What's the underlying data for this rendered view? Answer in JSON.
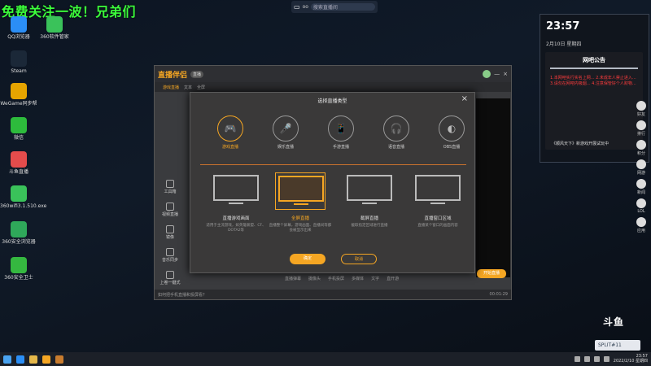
{
  "promo": {
    "text": "免费关注一波！兄弟们"
  },
  "desktop_icons": [
    {
      "label": "QQ浏览器",
      "color": "#2b8ef5"
    },
    {
      "label": "360软件管家",
      "color": "#3ac25a"
    },
    {
      "label": "Steam",
      "color": "#1b2838"
    },
    {
      "label": "WeGame同步帮",
      "color": "#e6a400"
    },
    {
      "label": "微信",
      "color": "#2dbb3c"
    },
    {
      "label": "斗鱼直播",
      "color": "#e44c4c"
    },
    {
      "label": "360wifi3.1.510.exe",
      "color": "#3ac25a"
    },
    {
      "label": "360安全浏览器",
      "color": "#2fa85a"
    },
    {
      "label": "360安全卫士",
      "color": "#35b840"
    }
  ],
  "top_capture": {
    "label": "oo",
    "search_placeholder": "搜索直播间"
  },
  "side_panel": {
    "time": "23:57",
    "date": "2月10日 星期四",
    "notice_title": "网吧公告",
    "notice_red": "1.本网吧实行实名上网... 2.未成年人禁止进入... 3.请勿在网吧内吸烟... 4.注意保管好个人财物...",
    "notice_footer": "《顺风天下》新游戏开展试玩中"
  },
  "right_bar": [
    "好友",
    "排行",
    "积分",
    "网游",
    "新闻",
    "LOL",
    "应用"
  ],
  "app": {
    "logo": "直播伴侣",
    "version": "直播",
    "tabs": [
      "游戏直播",
      "文本",
      "全屏"
    ],
    "left_nav": [
      "工具箱",
      "视频直播",
      "镜像",
      "音乐同步",
      "上卷一键式"
    ],
    "bottom_tabs": [
      "直播弹幕",
      "摄像头",
      "手机投屏",
      "多媒体",
      "文字",
      "直开游"
    ],
    "live_button": "开始直播",
    "status_left": "如何把手机直播和投屏看？",
    "status_time": "00:01:29"
  },
  "dialog": {
    "title": "选择直播类型",
    "close": "×",
    "types": [
      "游戏直播",
      "娱乐直播",
      "手游直播",
      "语音直播",
      "OBS直播"
    ],
    "type_icons": [
      "🎮",
      "🎤",
      "📱",
      "🎧",
      "◐"
    ],
    "modes": [
      {
        "name": "直播游戏画面",
        "desc": "适用于主流游戏，如英雄联盟、CF、DOTA2等"
      },
      {
        "name": "全屏直播",
        "desc": "直播整个屏幕，游戏画面、直播间等都会被显示出来"
      },
      {
        "name": "截屏直播",
        "desc": "截取指定区域进行直播"
      },
      {
        "name": "直播窗口区域",
        "desc": "直播某个窗口的画面内容"
      }
    ],
    "ok": "确定",
    "cancel": "取消"
  },
  "watermark": {
    "brand": "斗鱼",
    "badge": "SPLIT#11"
  },
  "clock": {
    "time": "23:57",
    "date": "2022/2/10 星期四"
  }
}
